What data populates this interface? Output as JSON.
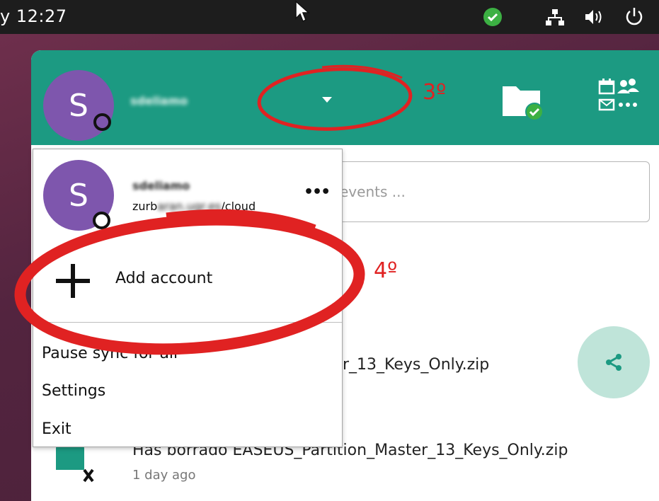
{
  "system_bar": {
    "clock": "y 12:27"
  },
  "header": {
    "avatar_letter": "S",
    "account_name": "sdeliamo"
  },
  "search": {
    "placeholder": "events ..."
  },
  "account_menu": {
    "avatar_letter": "S",
    "account_name": "sdeliamo",
    "server_url_prefix": "zurb",
    "server_url_blurred": "aran.ugr.es",
    "server_url_suffix": "/cloud",
    "more_label": "•••",
    "add_account_label": "Add account",
    "items": [
      {
        "label": "Pause sync for all"
      },
      {
        "label": "Settings"
      },
      {
        "label": "Exit"
      }
    ]
  },
  "activity": {
    "item1_text": "r_13_Keys_Only.zip",
    "item2_text": "Has borrado EASEUS_Partition_Master_13_Keys_Only.zip",
    "item2_time": "1 day ago"
  },
  "annotations": {
    "step3": "3º",
    "step4": "4º"
  },
  "colors": {
    "header": "#1c9a82",
    "avatar": "#7e56ad",
    "annotation": "#e02222"
  }
}
